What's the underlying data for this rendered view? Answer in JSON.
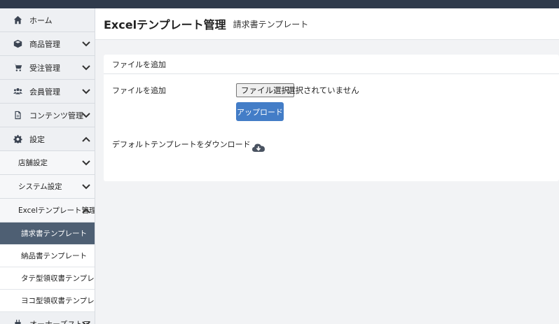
{
  "sidebar": {
    "items": [
      {
        "label": "ホーム",
        "icon": "home-icon"
      },
      {
        "label": "商品管理",
        "icon": "cube-icon"
      },
      {
        "label": "受注管理",
        "icon": "cart-icon"
      },
      {
        "label": "会員管理",
        "icon": "users-icon"
      },
      {
        "label": "コンテンツ管理",
        "icon": "file-icon"
      },
      {
        "label": "設定",
        "icon": "gear-icon"
      }
    ],
    "settings_sub": [
      {
        "label": "店舗設定"
      },
      {
        "label": "システム設定"
      },
      {
        "label": "Excelテンプレート管理"
      }
    ],
    "excel_sub": [
      {
        "label": "請求書テンプレート",
        "active": true
      },
      {
        "label": "納品書テンプレート"
      },
      {
        "label": "タテ型領収書テンプレート"
      },
      {
        "label": "ヨコ型領収書テンプレート"
      }
    ],
    "owner_store": {
      "label": "オーナーズストア"
    }
  },
  "header": {
    "title": "Excelテンプレート管理",
    "subtitle": "請求書テンプレート"
  },
  "card": {
    "heading": "ファイルを追加",
    "file_label": "ファイルを追加",
    "file_button": "ファイル選択",
    "file_status": "選択されていません",
    "upload_button": "アップロード",
    "download_label": "デフォルトテンプレートをダウンロード"
  },
  "colors": {
    "topbar": "#2f3a4b",
    "active_nav": "#4e5f73",
    "upload_button": "#437dc7"
  }
}
